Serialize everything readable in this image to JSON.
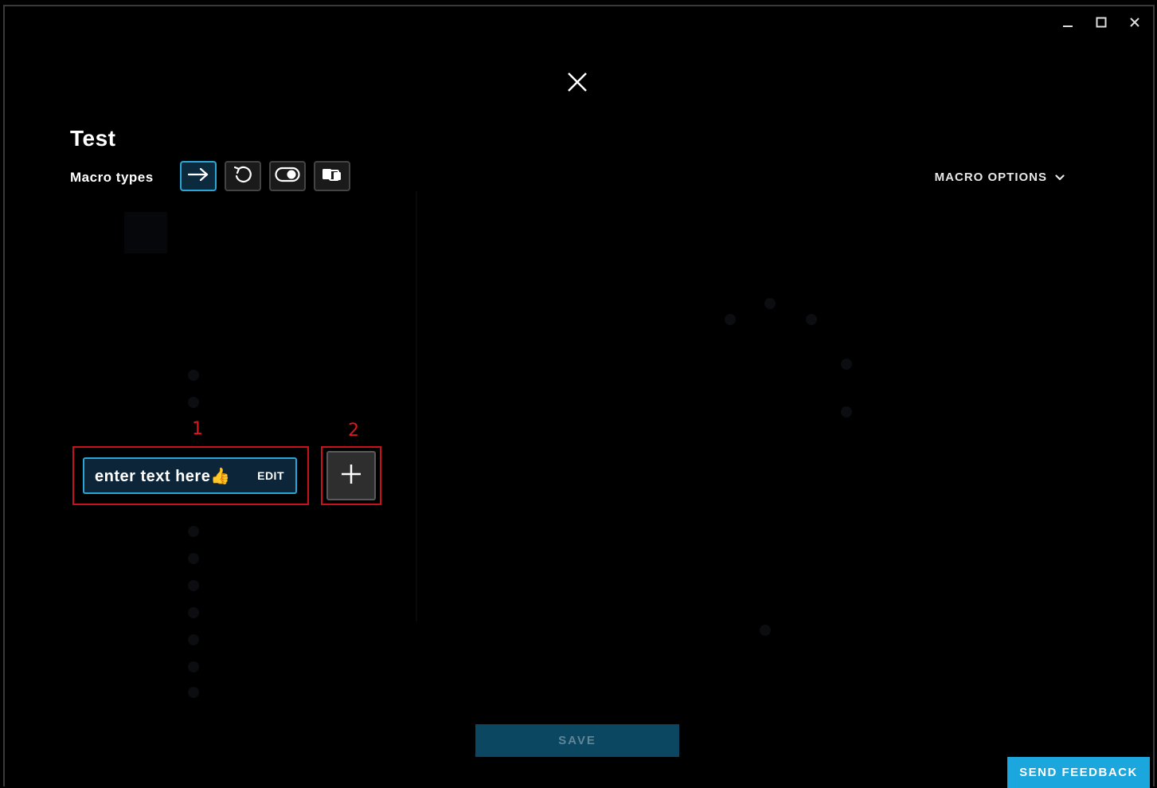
{
  "window": {
    "minimize_icon": "minimize-icon",
    "maximize_icon": "maximize-icon",
    "close_icon": "close-icon"
  },
  "overlay": {
    "close_icon": "close-x-icon"
  },
  "macro": {
    "title": "Test",
    "types_label": "Macro types",
    "types": [
      {
        "icon": "arrow-right-icon",
        "active": true
      },
      {
        "icon": "repeat-icon",
        "active": false
      },
      {
        "icon": "toggle-icon",
        "active": false
      },
      {
        "icon": "sequence-icon",
        "active": false
      }
    ],
    "options_label": "MACRO OPTIONS"
  },
  "annotations": {
    "marker_1": "1",
    "marker_2": "2"
  },
  "editor": {
    "text_chip_value": "enter text here👍",
    "edit_label": "EDIT",
    "add_icon": "plus-icon"
  },
  "footer": {
    "save_label": "SAVE",
    "feedback_label": "SEND FEEDBACK"
  },
  "colors": {
    "accent": "#1ba6dd",
    "save_bg": "#0b4760",
    "highlight": "#c8111b",
    "background": "#000000"
  }
}
